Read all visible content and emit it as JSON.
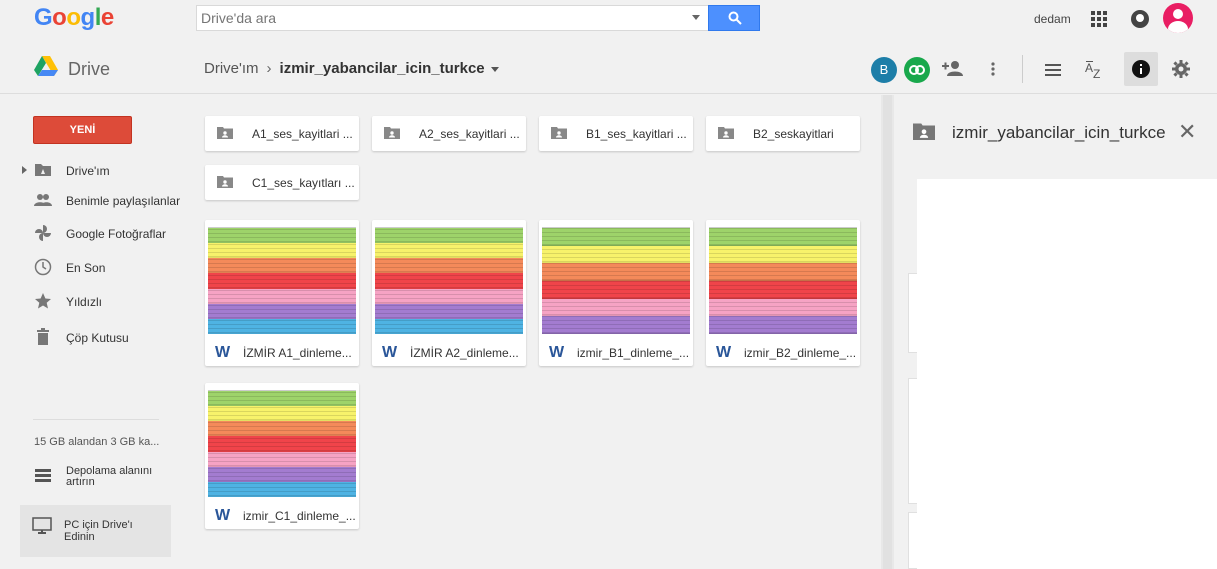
{
  "header": {
    "logo": "Google",
    "search_placeholder": "Drive'da ara",
    "user_name": "dedam"
  },
  "toolbar": {
    "app_name": "Drive",
    "breadcrumb_root": "Drive'ım",
    "breadcrumb_current": "izmir_yabancilar_icin_turkce",
    "shared_user_initial": "B"
  },
  "sidebar": {
    "new_button": "YENİ",
    "items": [
      {
        "label": "Drive'ım",
        "icon": "drive-folder-icon"
      },
      {
        "label": "Benimle paylaşılanlar",
        "icon": "people-icon"
      },
      {
        "label": "Google Fotoğraflar",
        "icon": "pinwheel-icon"
      },
      {
        "label": "En Son",
        "icon": "clock-icon"
      },
      {
        "label": "Yıldızlı",
        "icon": "star-icon"
      },
      {
        "label": "Çöp Kutusu",
        "icon": "trash-icon"
      }
    ],
    "storage_text": "15 GB alandan 3 GB ka...",
    "upgrade_line1": "Depolama alanını",
    "upgrade_line2": "artırın",
    "pc_line1": "PC için Drive'ı",
    "pc_line2": "Edinin"
  },
  "folders": [
    {
      "name": "A1_ses_kayitlari ..."
    },
    {
      "name": "A2_ses_kayitlari ..."
    },
    {
      "name": "B1_ses_kayitlari ..."
    },
    {
      "name": "B2_seskayitlari"
    },
    {
      "name": "C1_ses_kayıtları ..."
    }
  ],
  "files": [
    {
      "name": "İZMİR A1_dinleme...",
      "bands": [
        "#9ed36a",
        "#f7f26b",
        "#f48a5a",
        "#f0444a",
        "#f6a3c4",
        "#a37cd0",
        "#4fb3e3"
      ]
    },
    {
      "name": "İZMİR A2_dinleme...",
      "bands": [
        "#9ed36a",
        "#f7f26b",
        "#f48a5a",
        "#f0444a",
        "#f6a3c4",
        "#a37cd0",
        "#4fb3e3"
      ]
    },
    {
      "name": "izmir_B1_dinleme_...",
      "bands": [
        "#9ed36a",
        "#f7f26b",
        "#f48a5a",
        "#f0444a",
        "#f6a3c4",
        "#a37cd0"
      ]
    },
    {
      "name": "izmir_B2_dinleme_...",
      "bands": [
        "#9ed36a",
        "#f7f26b",
        "#f48a5a",
        "#f0444a",
        "#f6a3c4",
        "#a37cd0"
      ]
    },
    {
      "name": "izmir_C1_dinleme_...",
      "bands": [
        "#9ed36a",
        "#f7f26b",
        "#f48a5a",
        "#f0444a",
        "#f6a3c4",
        "#a37cd0",
        "#4fb3e3"
      ]
    }
  ],
  "details": {
    "title": "izmir_yabancilar_icin_turkce"
  },
  "colors": {
    "accent_blue": "#4d90fe",
    "new_red": "#dd4b39",
    "word_blue": "#2a5699"
  }
}
